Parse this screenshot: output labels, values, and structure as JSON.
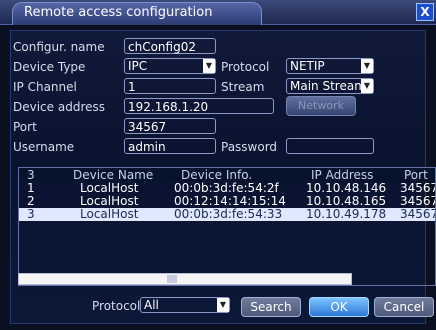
{
  "window": {
    "title": "Remote access configuration",
    "close": "X"
  },
  "form": {
    "config_name_label": "Configur. name",
    "config_name_value": "chConfig02",
    "device_type_label": "Device Type",
    "device_type_value": "IPC",
    "protocol_label": "Protocol",
    "protocol_value": "NETIP",
    "ip_channel_label": "IP Channel",
    "ip_channel_value": "1",
    "stream_label": "Stream",
    "stream_value": "Main Stream",
    "device_address_label": "Device address",
    "device_address_value": "192.168.1.20",
    "network_button": "Network",
    "port_label": "Port",
    "port_value": "34567",
    "username_label": "Username",
    "username_value": "admin",
    "password_label": "Password",
    "password_value": ""
  },
  "table": {
    "count": "3",
    "headers": [
      "Device Name",
      "Device Info.",
      "IP Address",
      "Port"
    ],
    "rows": [
      {
        "idx": "1",
        "name": "LocalHost",
        "info": "00:0b:3d:fe:54:2f",
        "ip": "10.10.48.146",
        "port": "34567"
      },
      {
        "idx": "2",
        "name": "LocalHost",
        "info": "00:12:14:14:15:14",
        "ip": "10.10.48.165",
        "port": "34567"
      },
      {
        "idx": "3",
        "name": "LocalHost",
        "info": "00:0b:3d:fe:54:33",
        "ip": "10.10.49.178",
        "port": "34567"
      }
    ]
  },
  "bottom": {
    "protocol_label": "Protocol",
    "protocol_value": "All",
    "search": "Search",
    "ok": "OK",
    "cancel": "Cancel"
  }
}
